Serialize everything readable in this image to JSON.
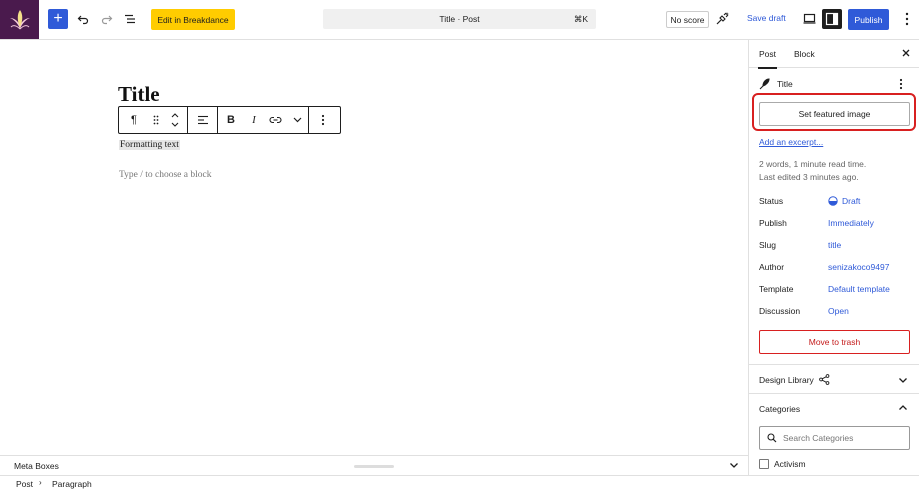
{
  "toolbar": {
    "edit_breakdance_label": "Edit in Breakdance",
    "command_title": "Title · Post",
    "command_shortcut": "⌘K",
    "no_score_label": "No score",
    "save_draft_label": "Save draft",
    "publish_label": "Publish",
    "accent_color": "#2f5ad8",
    "breakdance_color": "#ffcc00"
  },
  "editor": {
    "post_title": "Title",
    "paragraph_text": "Formatting text",
    "placeholder": "Type / to choose a block"
  },
  "block_toolbar": {
    "paragraph_icon": "¶",
    "bold_label": "B",
    "italic_label": "I"
  },
  "meta_boxes": {
    "label": "Meta Boxes"
  },
  "breadcrumb": {
    "items": [
      "Post",
      "Paragraph"
    ]
  },
  "sidebar": {
    "tabs": [
      "Post",
      "Block"
    ],
    "post_title": "Title",
    "featured_image_label": "Set featured image",
    "excerpt_link": "Add an excerpt...",
    "read_time": "2 words, 1 minute read time.",
    "last_edited": "Last edited 3 minutes ago.",
    "rows": [
      {
        "key": "Status",
        "value": "Draft"
      },
      {
        "key": "Publish",
        "value": "Immediately"
      },
      {
        "key": "Slug",
        "value": "title"
      },
      {
        "key": "Author",
        "value": "senizakoco9497"
      },
      {
        "key": "Template",
        "value": "Default template"
      },
      {
        "key": "Discussion",
        "value": "Open"
      }
    ],
    "trash_label": "Move to trash",
    "design_library_label": "Design Library",
    "categories_label": "Categories",
    "search_categories_placeholder": "Search Categories",
    "category_items": [
      "Activism"
    ]
  }
}
